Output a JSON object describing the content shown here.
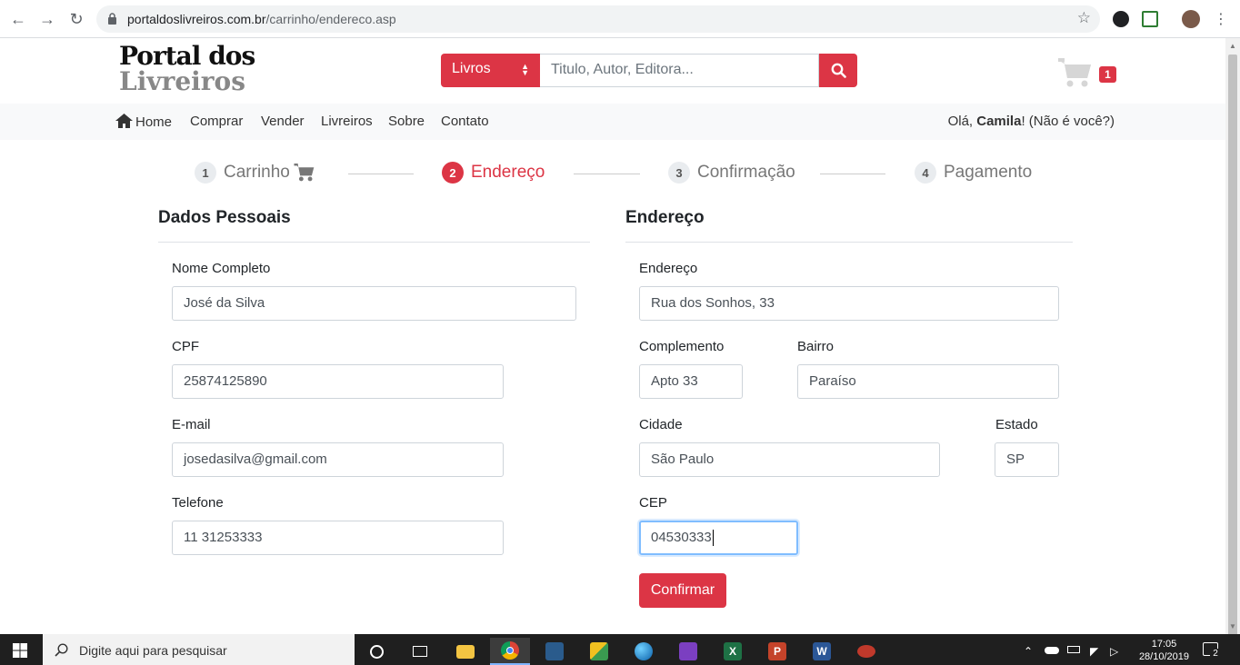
{
  "browser": {
    "url_domain": "portaldoslivreiros.com.br",
    "url_path": "/carrinho/endereco.asp"
  },
  "header": {
    "logo_line1": "Portal dos",
    "logo_line2": "Livreiros",
    "search_category": "Livros",
    "search_placeholder": "Titulo, Autor, Editora...",
    "cart_count": "1"
  },
  "menu": {
    "items": [
      "Home",
      "Comprar",
      "Vender",
      "Livreiros",
      "Sobre",
      "Contato"
    ],
    "greeting_prefix": "Olá, ",
    "user_name": "Camila",
    "greeting_suffix": "! (Não é você?)"
  },
  "steps": [
    {
      "num": "1",
      "label": "Carrinho",
      "active": false
    },
    {
      "num": "2",
      "label": "Endereço",
      "active": true
    },
    {
      "num": "3",
      "label": "Confirmação",
      "active": false
    },
    {
      "num": "4",
      "label": "Pagamento",
      "active": false
    }
  ],
  "personal": {
    "title": "Dados Pessoais",
    "name_label": "Nome Completo",
    "name_value": "José da Silva",
    "cpf_label": "CPF",
    "cpf_value": "25874125890",
    "email_label": "E-mail",
    "email_value": "josedasilva@gmail.com",
    "phone_label": "Telefone",
    "phone_value": "11 31253333"
  },
  "address": {
    "title": "Endereço",
    "street_label": "Endereço",
    "street_value": "Rua dos Sonhos, 33",
    "complement_label": "Complemento",
    "complement_value": "Apto 33",
    "district_label": "Bairro",
    "district_value": "Paraíso",
    "city_label": "Cidade",
    "city_value": "São Paulo",
    "state_label": "Estado",
    "state_value": "SP",
    "zip_label": "CEP",
    "zip_value": "04530333",
    "confirm_label": "Confirmar"
  },
  "taskbar": {
    "search_placeholder": "Digite aqui para pesquisar",
    "time": "17:05",
    "date": "28/10/2019",
    "notifications": "2"
  },
  "colors": {
    "accent": "#dc3545",
    "menubar_bg": "#f8f9fa",
    "focus_border": "#80bdff"
  }
}
